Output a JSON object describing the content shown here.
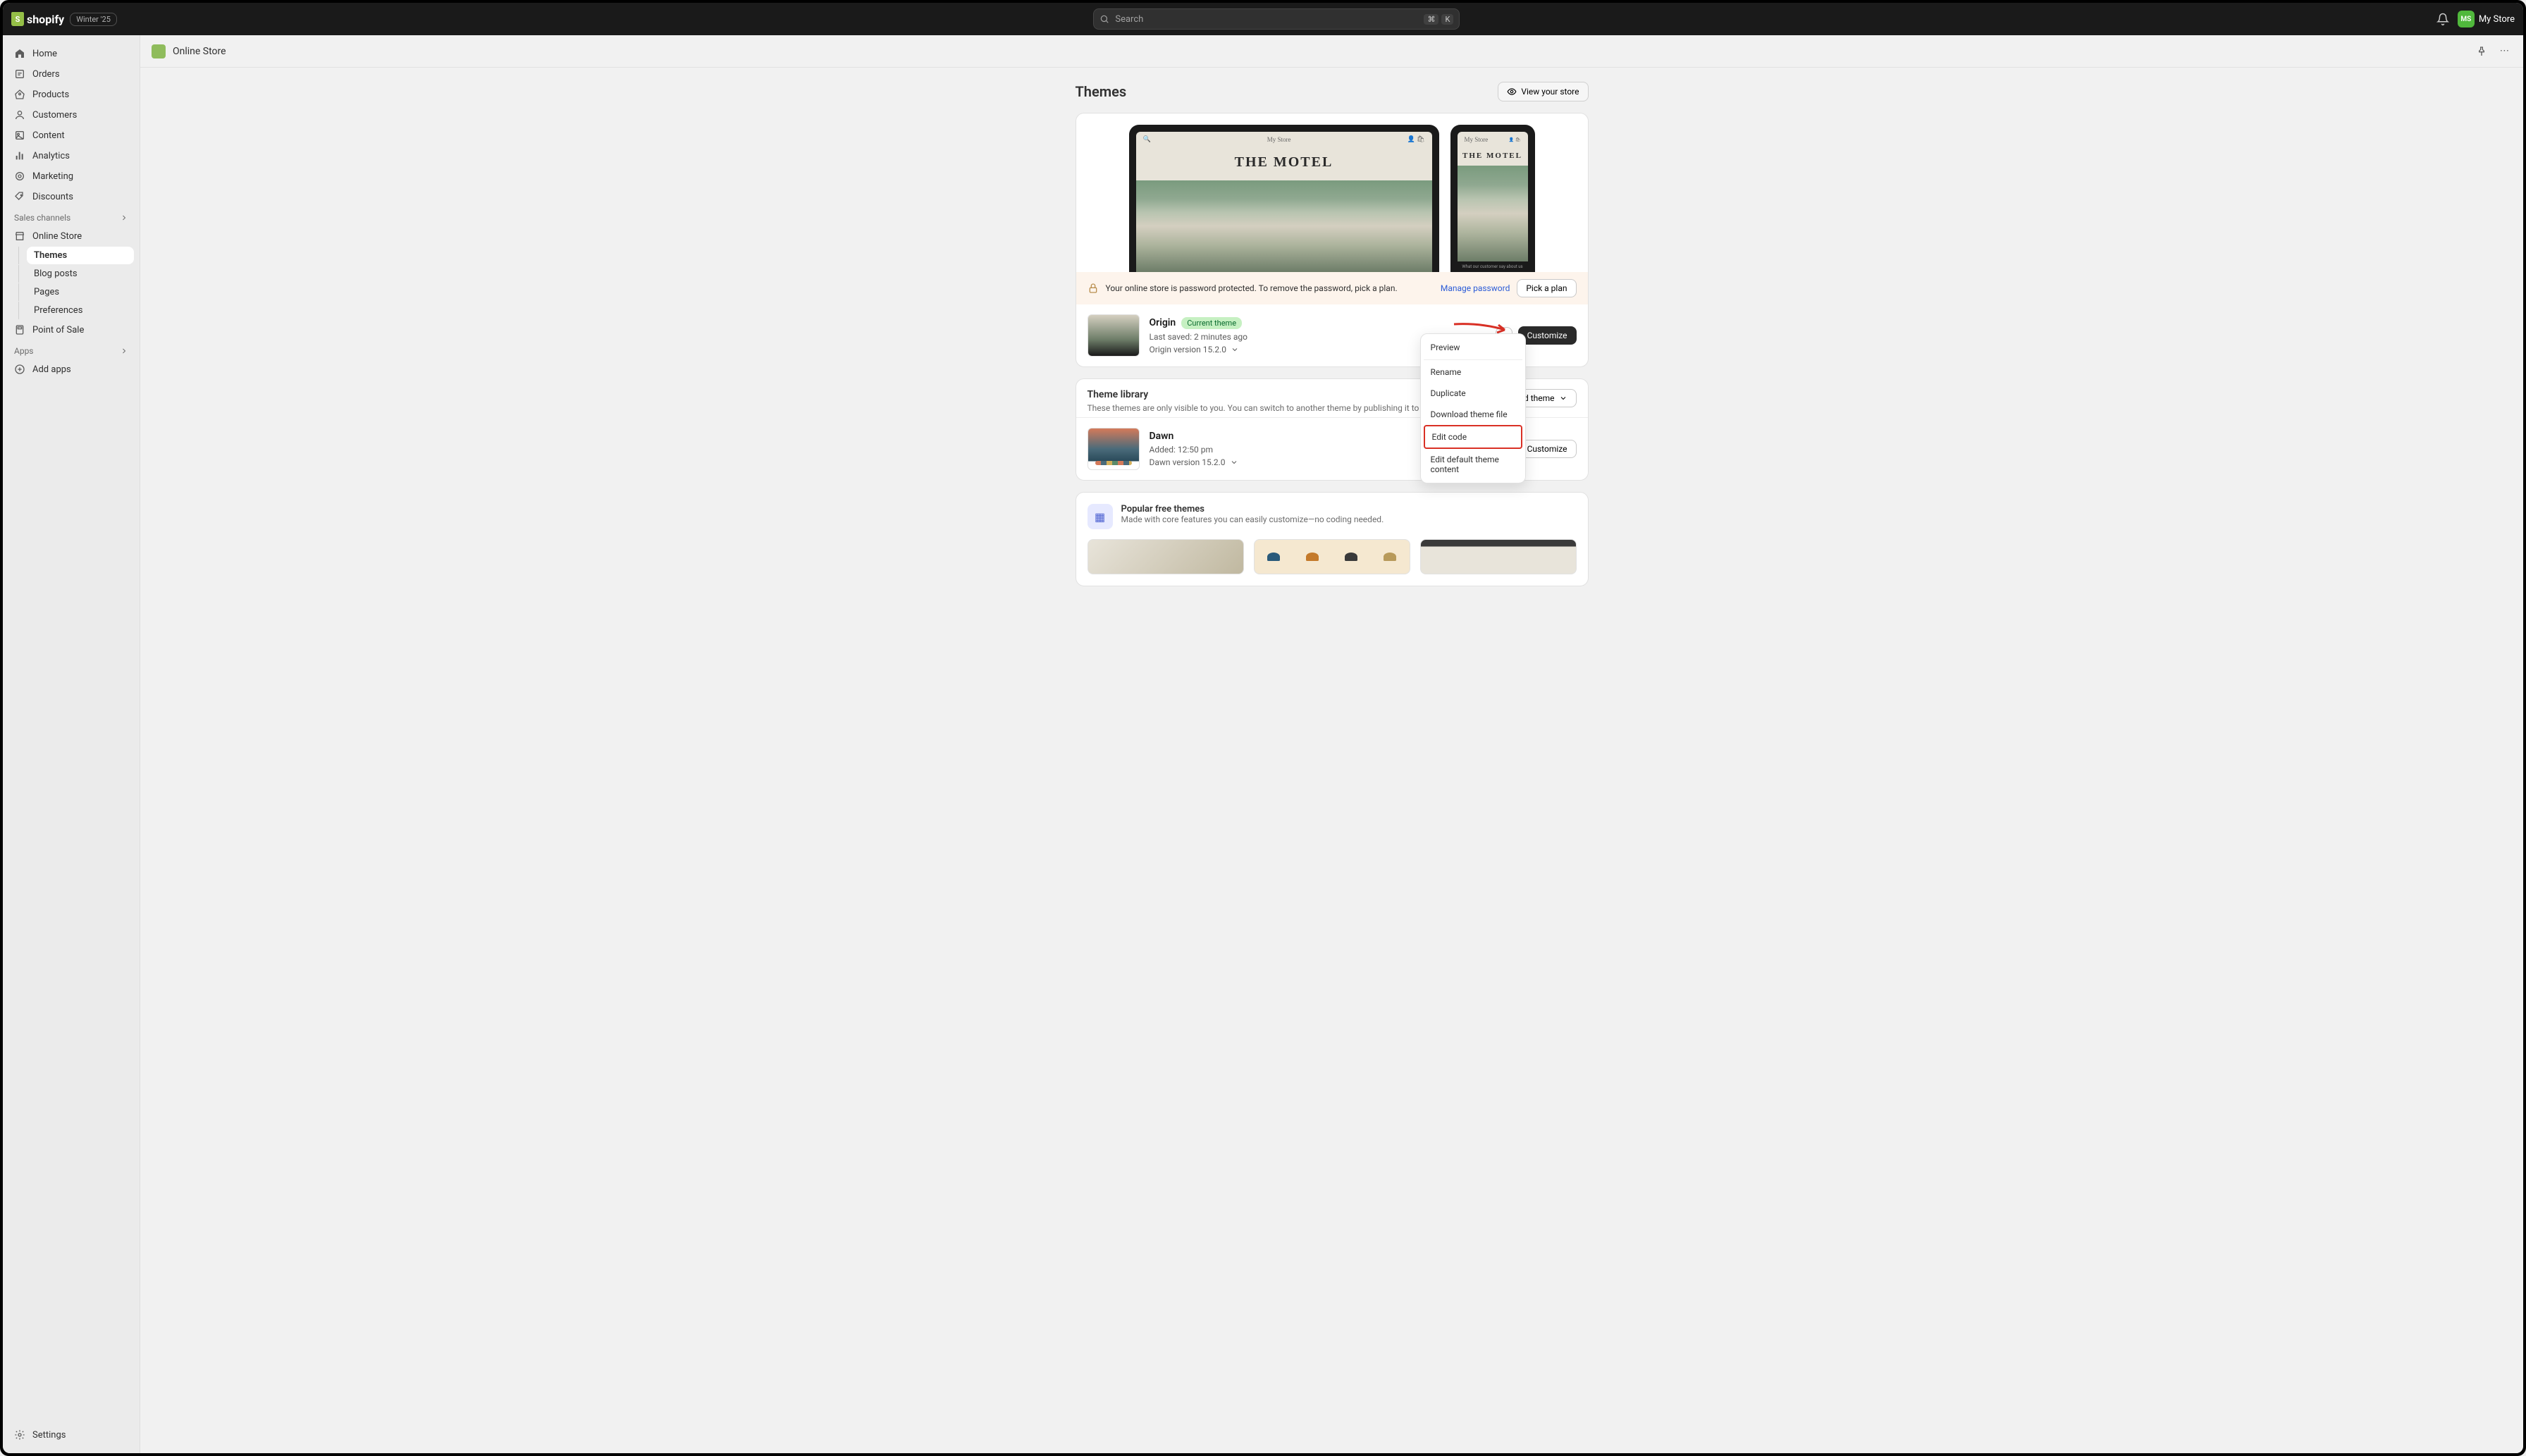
{
  "topbar": {
    "brand": "shopify",
    "badge": "Winter '25",
    "search_placeholder": "Search",
    "kbd1": "⌘",
    "kbd2": "K",
    "store_initials": "MS",
    "store_name": "My Store"
  },
  "sidebar": {
    "items": [
      {
        "label": "Home"
      },
      {
        "label": "Orders"
      },
      {
        "label": "Products"
      },
      {
        "label": "Customers"
      },
      {
        "label": "Content"
      },
      {
        "label": "Analytics"
      },
      {
        "label": "Marketing"
      },
      {
        "label": "Discounts"
      }
    ],
    "sales_channels_label": "Sales channels",
    "online_store": "Online Store",
    "online_sub": [
      {
        "label": "Themes"
      },
      {
        "label": "Blog posts"
      },
      {
        "label": "Pages"
      },
      {
        "label": "Preferences"
      }
    ],
    "pos": "Point of Sale",
    "apps_label": "Apps",
    "add_apps": "Add apps",
    "settings": "Settings"
  },
  "page": {
    "breadcrumb": "Online Store",
    "title": "Themes",
    "view_store": "View your store"
  },
  "preview": {
    "store_name": "My Store",
    "hero": "THE MOTEL",
    "mobile_foot": "What our customer say about us"
  },
  "password_banner": {
    "text": "Your online store is password protected. To remove the password, pick a plan.",
    "manage": "Manage password",
    "pick_plan": "Pick a plan"
  },
  "current_theme": {
    "name": "Origin",
    "pill": "Current theme",
    "last_saved": "Last saved: 2 minutes ago",
    "version": "Origin version 15.2.0",
    "customize": "Customize"
  },
  "dropdown": {
    "preview": "Preview",
    "rename": "Rename",
    "duplicate": "Duplicate",
    "download": "Download theme file",
    "edit_code": "Edit code",
    "edit_default": "Edit default theme content"
  },
  "library": {
    "title": "Theme library",
    "desc": "These themes are only visible to you. You can switch to another theme by publishing it to your store.",
    "add_theme": "Add theme",
    "dawn": {
      "name": "Dawn",
      "added": "Added: 12:50 pm",
      "version": "Dawn version 15.2.0",
      "customize": "Customize"
    }
  },
  "popular": {
    "title": "Popular free themes",
    "desc": "Made with core features you can easily customize—no coding needed."
  }
}
